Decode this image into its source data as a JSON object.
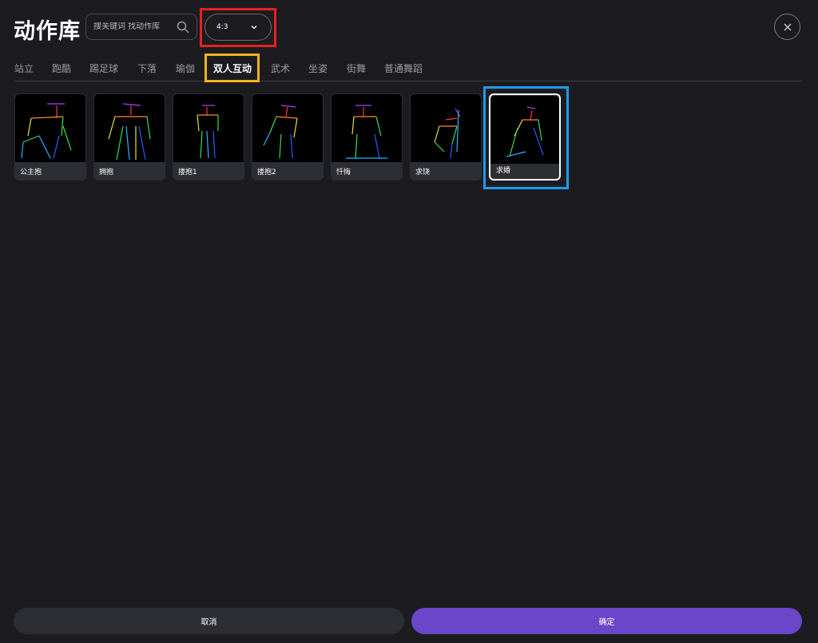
{
  "header": {
    "title": "动作库",
    "search_placeholder": "搜关键词 找动作库",
    "aspect_ratio": "4:3"
  },
  "tabs": [
    {
      "label": "站立",
      "active": false
    },
    {
      "label": "跑酷",
      "active": false
    },
    {
      "label": "踢足球",
      "active": false
    },
    {
      "label": "下落",
      "active": false
    },
    {
      "label": "瑜伽",
      "active": false
    },
    {
      "label": "双人互动",
      "active": true
    },
    {
      "label": "武术",
      "active": false
    },
    {
      "label": "坐姿",
      "active": false
    },
    {
      "label": "街舞",
      "active": false
    },
    {
      "label": "普通舞蹈",
      "active": false
    }
  ],
  "cards": [
    {
      "label": "公主抱",
      "selected": false
    },
    {
      "label": "拥抱",
      "selected": false
    },
    {
      "label": "搂抱1",
      "selected": false
    },
    {
      "label": "搂抱2",
      "selected": false
    },
    {
      "label": "忏悔",
      "selected": false
    },
    {
      "label": "求饶",
      "selected": false
    },
    {
      "label": "求婚",
      "selected": true
    }
  ],
  "footer": {
    "cancel_label": "取消",
    "confirm_label": "确定"
  },
  "colors": {
    "background": "#1c1c20",
    "confirm": "#6a46c8",
    "highlight_red": "#e8211f",
    "highlight_yellow": "#f4b41a",
    "highlight_blue": "#1e9bf0"
  }
}
